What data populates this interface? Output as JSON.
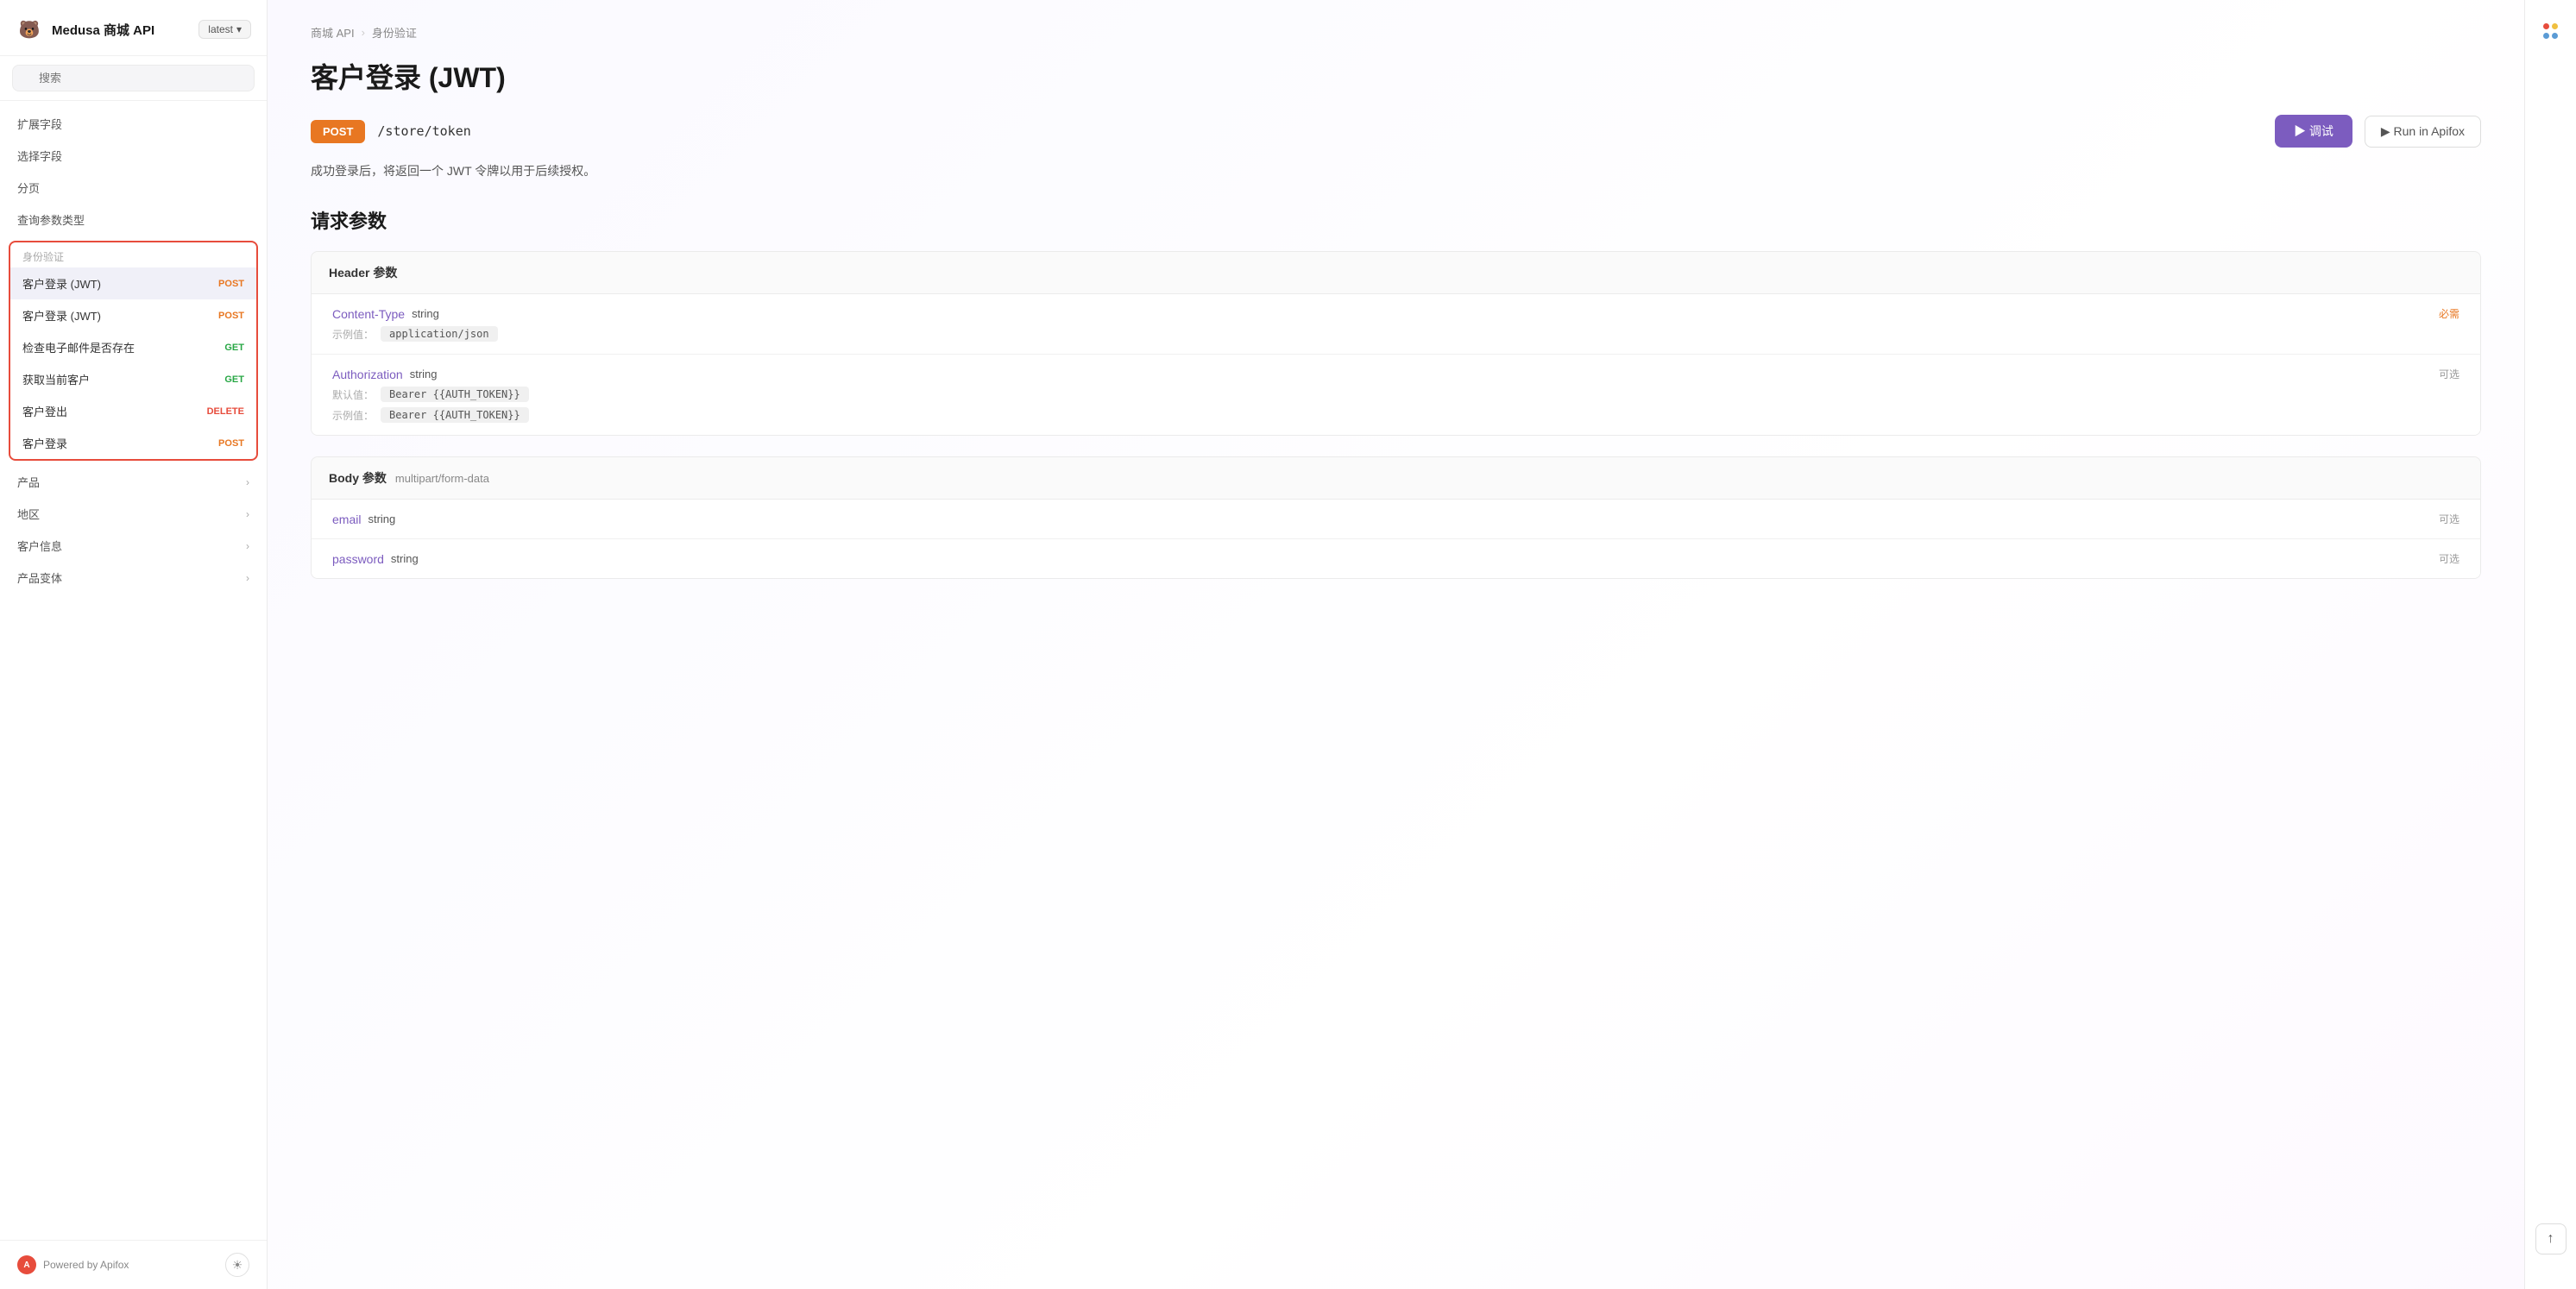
{
  "sidebar": {
    "logo": "🐻",
    "title": "Medusa 商城 API",
    "version": {
      "label": "latest",
      "chevron": "▾"
    },
    "search": {
      "placeholder": "搜索"
    },
    "pre_items": [
      {
        "label": "扩展字段",
        "method": null
      },
      {
        "label": "选择字段",
        "method": null
      },
      {
        "label": "分页",
        "method": null
      },
      {
        "label": "查询参数类型",
        "method": null
      }
    ],
    "auth_section": {
      "label": "身份验证",
      "items": [
        {
          "label": "客户登录 (JWT)",
          "method": "POST",
          "active": true
        },
        {
          "label": "客户登录 (JWT)",
          "method": "POST",
          "active": false
        },
        {
          "label": "检查电子邮件是否存在",
          "method": "GET",
          "active": false
        },
        {
          "label": "获取当前客户",
          "method": "GET",
          "active": false
        },
        {
          "label": "客户登出",
          "method": "DELETE",
          "active": false
        },
        {
          "label": "客户登录",
          "method": "POST",
          "active": false
        }
      ]
    },
    "post_items": [
      {
        "label": "产品",
        "has_children": true
      },
      {
        "label": "地区",
        "has_children": true
      },
      {
        "label": "客户信息",
        "has_children": true
      },
      {
        "label": "产品变体",
        "has_children": true
      }
    ],
    "footer": {
      "powered_by": "Powered by Apifox"
    }
  },
  "main": {
    "breadcrumb": {
      "items": [
        "商城 API",
        "身份验证"
      ]
    },
    "title": "客户登录 (JWT)",
    "endpoint": {
      "method": "POST",
      "path": "/store/token"
    },
    "buttons": {
      "test": "▶ 调试",
      "apifox": "▶ Run in Apifox"
    },
    "description": "成功登录后，将返回一个 JWT 令牌以用于后续授权。",
    "request_params": {
      "section_title": "请求参数",
      "header_group": {
        "label": "Header 参数",
        "params": [
          {
            "name": "Content-Type",
            "type": "string",
            "required": true,
            "required_label": "必需",
            "optional_label": "",
            "details": [
              {
                "label": "示例值：",
                "value": "application/json"
              }
            ]
          },
          {
            "name": "Authorization",
            "type": "string",
            "required": false,
            "required_label": "",
            "optional_label": "可选",
            "details": [
              {
                "label": "默认值：",
                "value": "Bearer {{AUTH_TOKEN}}"
              },
              {
                "label": "示例值：",
                "value": "Bearer {{AUTH_TOKEN}}"
              }
            ]
          }
        ]
      },
      "body_group": {
        "label": "Body 参数",
        "type_label": "multipart/form-data",
        "params": [
          {
            "name": "email",
            "type": "string",
            "required": false,
            "optional_label": "可选",
            "details": []
          },
          {
            "name": "password",
            "type": "string",
            "required": false,
            "optional_label": "可选",
            "details": []
          }
        ]
      }
    }
  },
  "colors": {
    "post_badge_bg": "#e87722",
    "test_btn_bg": "#7c5cbf",
    "param_name_color": "#7c5cbf",
    "required_color": "#e87722",
    "delete_color": "#e74c3c",
    "get_color": "#28a745"
  }
}
